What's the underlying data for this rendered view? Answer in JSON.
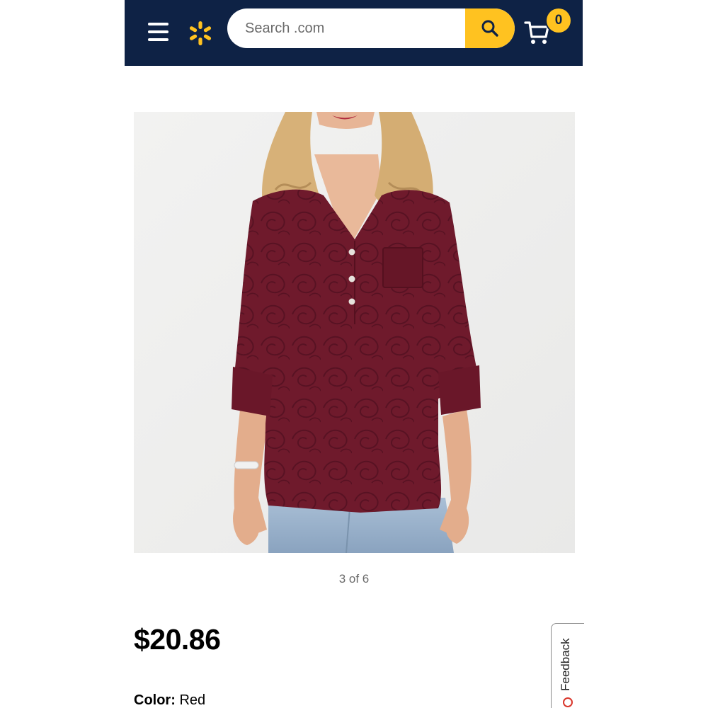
{
  "header": {
    "background_color": "#0e2245",
    "accent_color": "#ffc220",
    "menu_icon": "hamburger-menu-icon",
    "logo_icon": "walmart-spark-icon",
    "search": {
      "placeholder": "Search .com",
      "value": "",
      "button_icon": "search-icon"
    },
    "cart": {
      "icon": "cart-icon",
      "count": "0"
    }
  },
  "product": {
    "image": {
      "description_icon": "product-photo",
      "shirt_color": "#6f1a2c"
    },
    "image_counter": "3 of 6",
    "price": "$20.86",
    "color_label": "Color:",
    "color_value": "Red"
  },
  "feedback": {
    "label": "Feedback",
    "icon": "feedback-circle-icon"
  }
}
